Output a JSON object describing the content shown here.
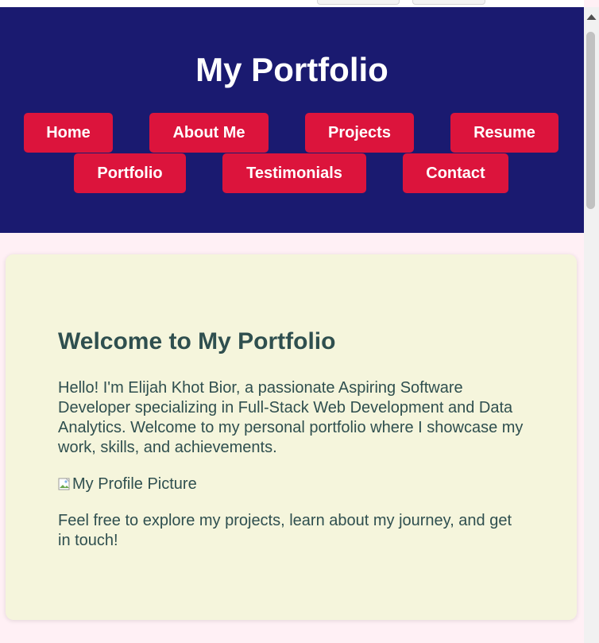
{
  "header": {
    "title": "My Portfolio"
  },
  "nav": {
    "items": [
      {
        "label": "Home"
      },
      {
        "label": "About Me"
      },
      {
        "label": "Projects"
      },
      {
        "label": "Resume"
      },
      {
        "label": "Portfolio"
      },
      {
        "label": "Testimonials"
      },
      {
        "label": "Contact"
      }
    ]
  },
  "main": {
    "heading": "Welcome to My Portfolio",
    "intro": "Hello! I'm Elijah Khot Bior, a passionate Aspiring Software Developer specializing in Full-Stack Web Development and Data Analytics. Welcome to my personal portfolio where I showcase my work, skills, and achievements.",
    "profile_image_alt": "My Profile Picture",
    "outro": "Feel free to explore my projects, learn about my journey, and get in touch!"
  },
  "colors": {
    "header_bg": "#1a1a70",
    "nav_button_bg": "#dc143c",
    "card_bg": "#f5f5dc",
    "page_bg": "#fff0f5",
    "text": "#2f4f4f"
  },
  "icons": {
    "broken_image": "broken-image-icon",
    "scroll_up": "arrow-up-icon"
  }
}
